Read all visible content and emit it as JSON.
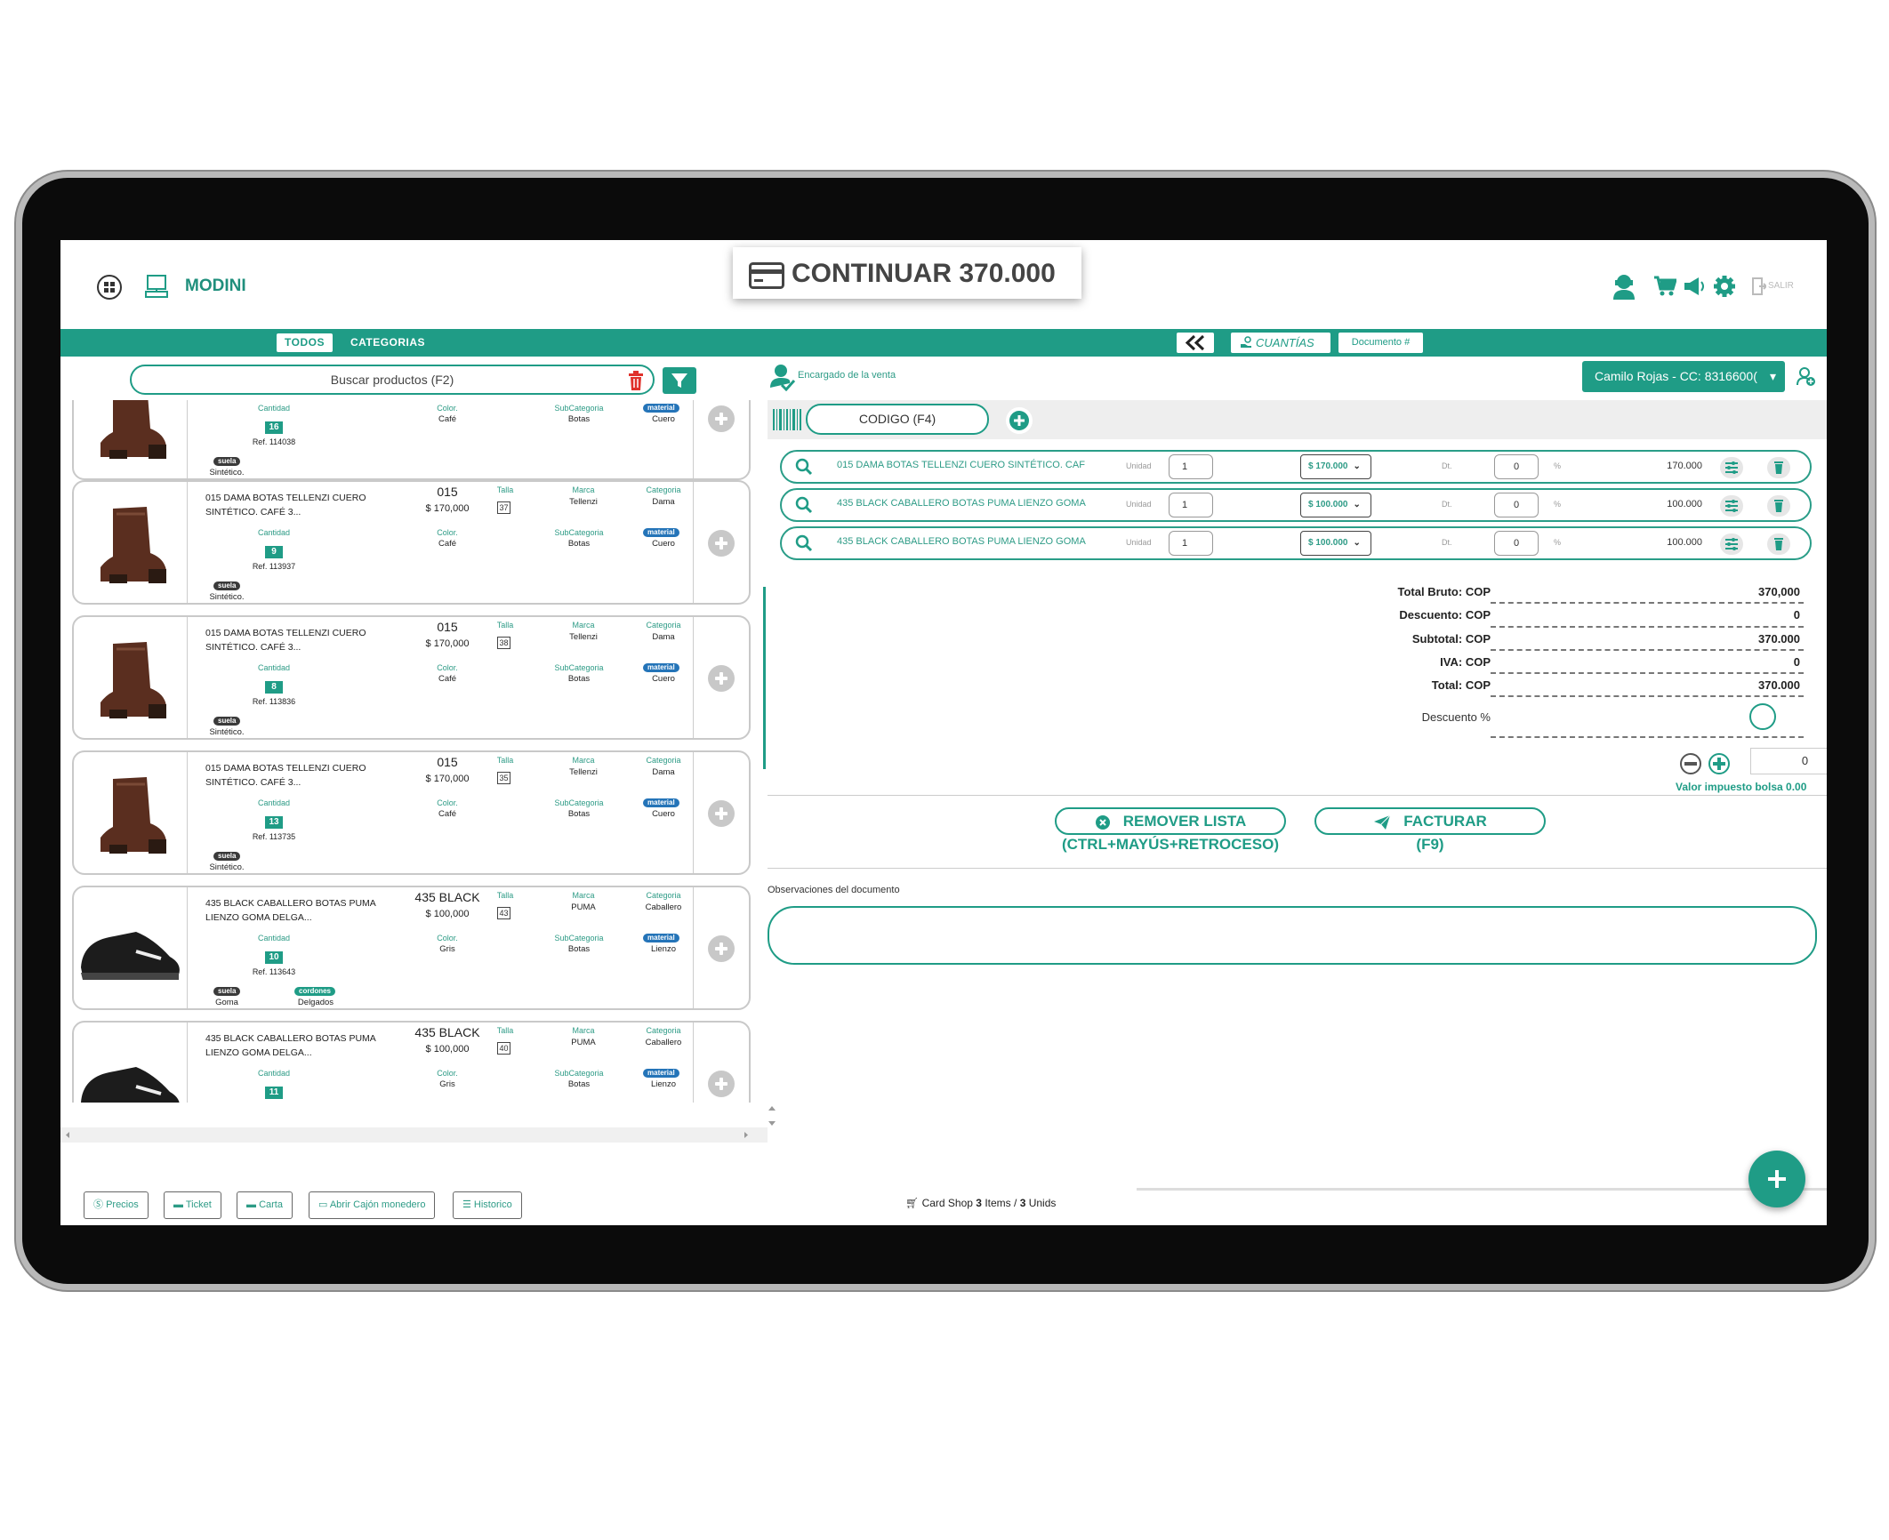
{
  "app": {
    "brand": "MODINI",
    "logout_label": "SALIR",
    "continue_label": "CONTINUAR 370.000"
  },
  "toolbar": {
    "tab_all": "TODOS",
    "tab_categories": "CATEGORIAS",
    "quantities_label": "CUANTÍAS",
    "document_label": "Documento #"
  },
  "search": {
    "placeholder": "Buscar productos (F2)"
  },
  "products": [
    {
      "name": "",
      "code": "",
      "price": "",
      "size": "",
      "brand": "",
      "category": "",
      "qty": "16",
      "color": "Café",
      "subcategory": "Botas",
      "material": "Cuero",
      "ref": "Ref. 114038",
      "sole_label": "suela",
      "sole": "Sintético.",
      "extra_label": "",
      "extra": ""
    },
    {
      "name": "015 DAMA BOTAS TELLENZI CUERO SINTÉTICO. CAFÉ 3...",
      "code": "015",
      "price": "$ 170,000",
      "size": "37",
      "brand": "Tellenzi",
      "category": "Dama",
      "qty": "9",
      "color": "Café",
      "subcategory": "Botas",
      "material": "Cuero",
      "ref": "Ref. 113937",
      "sole_label": "suela",
      "sole": "Sintético.",
      "extra_label": "",
      "extra": ""
    },
    {
      "name": "015 DAMA BOTAS TELLENZI CUERO SINTÉTICO. CAFÉ 3...",
      "code": "015",
      "price": "$ 170,000",
      "size": "38",
      "brand": "Tellenzi",
      "category": "Dama",
      "qty": "8",
      "color": "Café",
      "subcategory": "Botas",
      "material": "Cuero",
      "ref": "Ref. 113836",
      "sole_label": "suela",
      "sole": "Sintético.",
      "extra_label": "",
      "extra": ""
    },
    {
      "name": "015 DAMA BOTAS TELLENZI CUERO SINTÉTICO. CAFÉ 3...",
      "code": "015",
      "price": "$ 170,000",
      "size": "35",
      "brand": "Tellenzi",
      "category": "Dama",
      "qty": "13",
      "color": "Café",
      "subcategory": "Botas",
      "material": "Cuero",
      "ref": "Ref. 113735",
      "sole_label": "suela",
      "sole": "Sintético.",
      "extra_label": "",
      "extra": ""
    },
    {
      "name": "435 BLACK CABALLERO BOTAS PUMA  LIENZO GOMA DELGA...",
      "code": "435 BLACK",
      "price": "$ 100,000",
      "size": "43",
      "brand": "PUMA",
      "category": "Caballero",
      "qty": "10",
      "color": "Gris",
      "subcategory": "Botas",
      "material": "Lienzo",
      "ref": "Ref. 113643",
      "sole_label": "suela",
      "sole": "Goma",
      "extra_label": "cordones",
      "extra": "Delgados"
    },
    {
      "name": "435 BLACK CABALLERO BOTAS PUMA  LIENZO GOMA DELGA...",
      "code": "435 BLACK",
      "price": "$ 100,000",
      "size": "40",
      "brand": "PUMA",
      "category": "Caballero",
      "qty": "11",
      "color": "Gris",
      "subcategory": "Botas",
      "material": "Lienzo",
      "ref": "",
      "sole_label": "",
      "sole": "",
      "extra_label": "",
      "extra": ""
    }
  ],
  "labels": {
    "size": "Talla",
    "brand": "Marca",
    "category": "Categoria",
    "quantity": "Cantidad",
    "color": "Color.",
    "subcategory": "SubCategoria",
    "material": "material"
  },
  "sale": {
    "seller_label": "Encargado de la venta",
    "customer": "Camilo Rojas - CC: 8316600(",
    "code_placeholder": "CODIGO (F4)",
    "unit_label": "Unidad",
    "discount_label": "Dt.",
    "percent": "%",
    "lines": [
      {
        "desc": "015 DAMA BOTAS TELLENZI   CUERO SINTÉTICO.  CAF",
        "qty": "1",
        "price": "$ 170.000",
        "discount": "0",
        "total": "170.000"
      },
      {
        "desc": "435 BLACK CABALLERO BOTAS PUMA   LIENZO GOMA",
        "qty": "1",
        "price": "$ 100.000",
        "discount": "0",
        "total": "100.000"
      },
      {
        "desc": "435 BLACK CABALLERO BOTAS PUMA   LIENZO GOMA",
        "qty": "1",
        "price": "$ 100.000",
        "discount": "0",
        "total": "100.000"
      }
    ]
  },
  "totals": {
    "gross_label": "Total Bruto: COP",
    "gross": "370,000",
    "discount_label": "Descuento: COP",
    "discount": "0",
    "subtotal_label": "Subtotal: COP",
    "subtotal": "370.000",
    "tax_label": "IVA: COP",
    "tax": "0",
    "total_label": "Total: COP",
    "total": "370.000",
    "discount_pct_label": "Descuento %",
    "bag_tax_value": "0",
    "bag_tax_label": "Valor impuesto bolsa 0.00"
  },
  "actions": {
    "remove_label": "REMOVER LISTA",
    "remove_shortcut": "(CTRL+MAYÚS+RETROCESO)",
    "invoice_label": "FACTURAR",
    "invoice_shortcut": "(F9)"
  },
  "notes": {
    "label": "Observaciones del documento",
    "value": ""
  },
  "footer": {
    "prices": "Precios",
    "ticket": "Ticket",
    "letter": "Carta",
    "drawer": "Abrir Cajón monedero",
    "history": "Historico",
    "cart_prefix": "Card Shop",
    "items_count": "3",
    "items_label": "Items /",
    "units_count": "3",
    "units_label": "Unids"
  },
  "colors": {
    "accent": "#1f9c86",
    "delete": "#e0312b",
    "device": "#0b0b0b"
  }
}
